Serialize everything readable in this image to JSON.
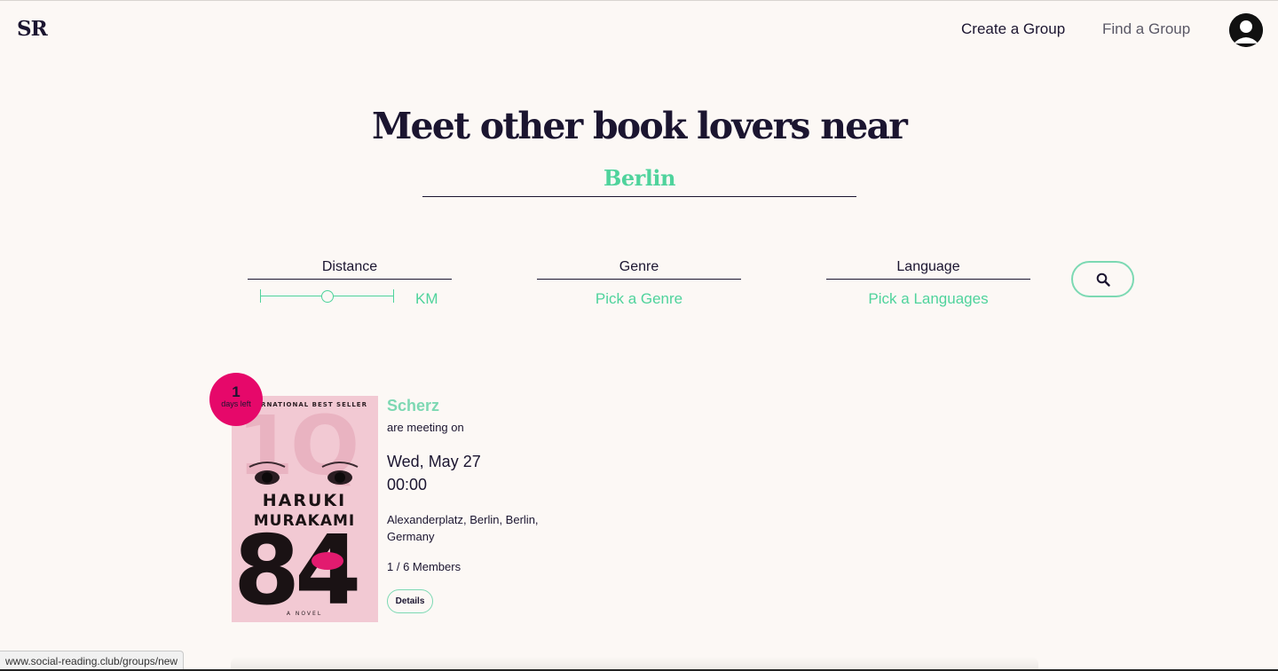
{
  "header": {
    "logo": "SR",
    "nav": {
      "create": "Create a Group",
      "find": "Find a Group"
    }
  },
  "hero": {
    "title": "Meet other book lovers near",
    "city": "Berlin"
  },
  "filters": {
    "distance": {
      "label": "Distance",
      "unit": "KM",
      "value_fraction": 0.5
    },
    "genre": {
      "label": "Genre",
      "value": "Pick a Genre"
    },
    "language": {
      "label": "Language",
      "value": "Pick a Languages"
    }
  },
  "card": {
    "badge_number": "1",
    "badge_text": "days left",
    "book": {
      "top_text": "INTERNATIONAL BEST SELLER",
      "author_first": "HARUKI",
      "author_last": "MURAKAMI",
      "title_top": "1Q",
      "title_bottom": "84",
      "bottom_text": "A NOVEL"
    },
    "group_name": "Scherz",
    "meeting_text": "are meeting on",
    "date": "Wed, May 27",
    "time": "00:00",
    "address": "Alexanderplatz, Berlin, Berlin, Germany",
    "members": "1 / 6 Members",
    "details_label": "Details"
  },
  "status_url": "www.social-reading.club/groups/new",
  "colors": {
    "accent": "#4fd39c",
    "badge": "#e6086a",
    "text": "#1b1530",
    "background": "#fcf8f5"
  }
}
